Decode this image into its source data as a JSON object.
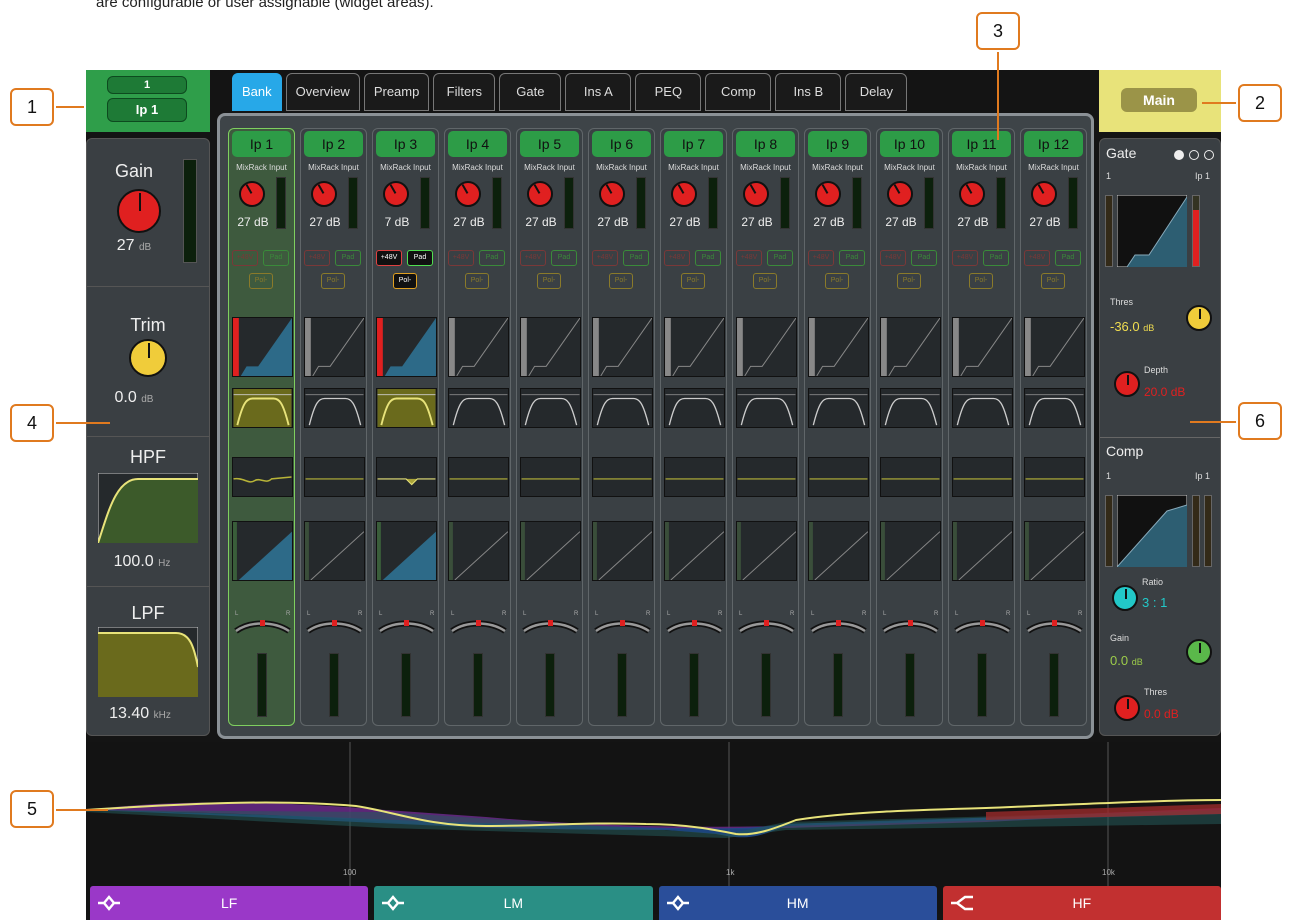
{
  "caption": "are configurable or user assignable (widget areas).",
  "callouts": [
    "1",
    "2",
    "3",
    "4",
    "5",
    "6"
  ],
  "channel_select": {
    "number": "1",
    "name": "Ip 1"
  },
  "main_button": "Main",
  "tabs": [
    "Bank",
    "Overview",
    "Preamp",
    "Filters",
    "Gate",
    "Ins A",
    "PEQ",
    "Comp",
    "Ins B",
    "Delay"
  ],
  "left_panel": {
    "gain_title": "Gain",
    "gain_value": "27",
    "gain_unit": "dB",
    "trim_title": "Trim",
    "trim_value": "0.0",
    "trim_unit": "dB",
    "hpf_title": "HPF",
    "hpf_value": "100.0",
    "hpf_unit": "Hz",
    "lpf_title": "LPF",
    "lpf_value": "13.40",
    "lpf_unit": "kHz"
  },
  "strips": [
    {
      "name": "Ip 1",
      "source": "MixRack Input",
      "gain": "27 dB",
      "phantom": "+48V",
      "pad": "Pad",
      "pol": "Pol-"
    },
    {
      "name": "Ip 2",
      "source": "MixRack Input",
      "gain": "27 dB",
      "phantom": "+48V",
      "pad": "Pad",
      "pol": "Pol-"
    },
    {
      "name": "Ip 3",
      "source": "MixRack Input",
      "gain": "7 dB",
      "phantom": "+48V",
      "pad": "Pad",
      "pol": "Pol-"
    },
    {
      "name": "Ip 4",
      "source": "MixRack Input",
      "gain": "27 dB",
      "phantom": "+48V",
      "pad": "Pad",
      "pol": "Pol-"
    },
    {
      "name": "Ip 5",
      "source": "MixRack Input",
      "gain": "27 dB",
      "phantom": "+48V",
      "pad": "Pad",
      "pol": "Pol-"
    },
    {
      "name": "Ip 6",
      "source": "MixRack Input",
      "gain": "27 dB",
      "phantom": "+48V",
      "pad": "Pad",
      "pol": "Pol-"
    },
    {
      "name": "Ip 7",
      "source": "MixRack Input",
      "gain": "27 dB",
      "phantom": "+48V",
      "pad": "Pad",
      "pol": "Pol-"
    },
    {
      "name": "Ip 8",
      "source": "MixRack Input",
      "gain": "27 dB",
      "phantom": "+48V",
      "pad": "Pad",
      "pol": "Pol-"
    },
    {
      "name": "Ip 9",
      "source": "MixRack Input",
      "gain": "27 dB",
      "phantom": "+48V",
      "pad": "Pad",
      "pol": "Pol-"
    },
    {
      "name": "Ip 10",
      "source": "MixRack Input",
      "gain": "27 dB",
      "phantom": "+48V",
      "pad": "Pad",
      "pol": "Pol-"
    },
    {
      "name": "Ip 11",
      "source": "MixRack Input",
      "gain": "27 dB",
      "phantom": "+48V",
      "pad": "Pad",
      "pol": "Pol-"
    },
    {
      "name": "Ip 12",
      "source": "MixRack Input",
      "gain": "27 dB",
      "phantom": "+48V",
      "pad": "Pad",
      "pol": "Pol-"
    }
  ],
  "right_panel": {
    "gate_title": "Gate",
    "gate_in": "1",
    "gate_ch": "Ip 1",
    "thres_label": "Thres",
    "thres_value": "-36.0",
    "thres_unit": "dB",
    "depth_label": "Depth",
    "depth_value": "20.0 dB",
    "comp_title": "Comp",
    "comp_in": "1",
    "comp_ch": "Ip 1",
    "ratio_label": "Ratio",
    "ratio_value": "3 : 1",
    "cgain_label": "Gain",
    "cgain_value": "0.0",
    "cgain_unit": "dB",
    "cthres_label": "Thres",
    "cthres_value": "0.0 dB"
  },
  "eq": {
    "ticks": [
      "100",
      "1k",
      "10k"
    ]
  },
  "eq_bands": [
    {
      "label": "LF",
      "color": "#9a38c8"
    },
    {
      "label": "LM",
      "color": "#2a8f85"
    },
    {
      "label": "HM",
      "color": "#2a4e9a"
    },
    {
      "label": "HF",
      "color": "#c23030"
    }
  ],
  "pan_labels": {
    "l": "L",
    "r": "R"
  },
  "colors": {
    "accent_blue": "#27a8e8",
    "channel_green": "#2d9c47",
    "main_yellow": "#e8e37a",
    "callout_orange": "#e07a1f"
  }
}
